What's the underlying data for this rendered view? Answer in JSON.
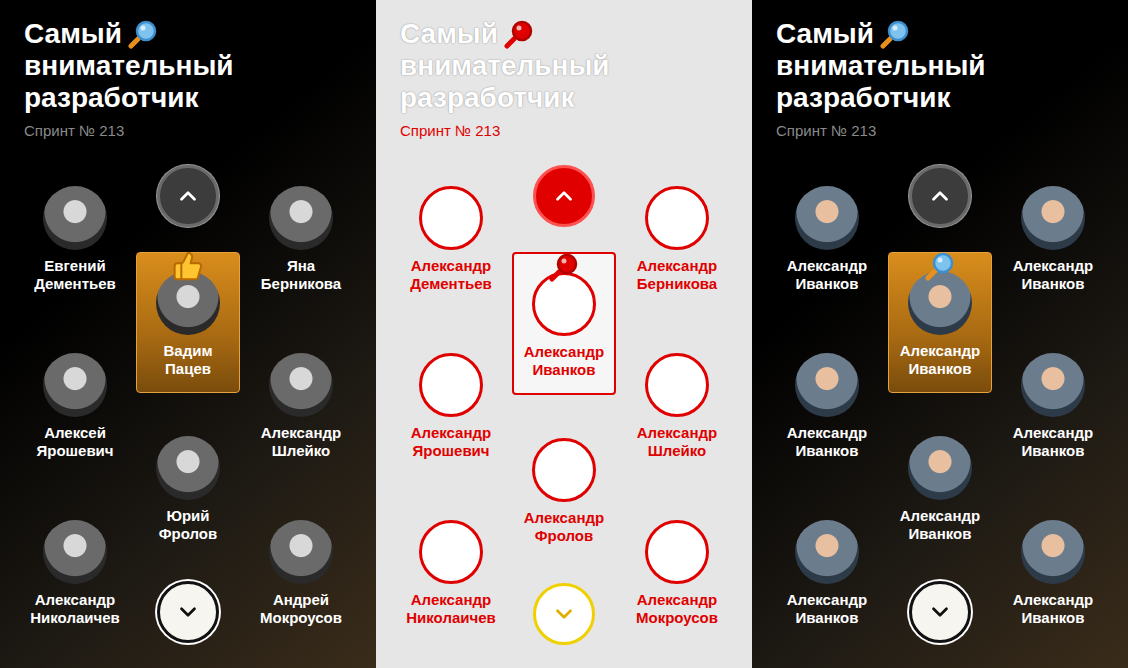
{
  "panels": [
    {
      "kind": "dark",
      "photos": "grayscale",
      "badge": "thumbs-up",
      "title_lines": [
        "Самый",
        "внимательный",
        "разработчик"
      ],
      "sprint": "Спринт № 213",
      "columns": [
        {
          "people": [
            {
              "first": "Евгений",
              "last": "Дементьев",
              "selected": false
            },
            {
              "first": "Алексей",
              "last": "Ярошевич",
              "selected": false
            },
            {
              "first": "Александр",
              "last": "Николаичев",
              "selected": false
            }
          ]
        },
        {
          "people": [
            {
              "first": "Вадим",
              "last": "Пацев",
              "selected": true
            },
            {
              "first": "Юрий",
              "last": "Фролов",
              "selected": false
            }
          ]
        },
        {
          "people": [
            {
              "first": "Яна",
              "last": "Берникова",
              "selected": false
            },
            {
              "first": "Александр",
              "last": "Шлейко",
              "selected": false
            },
            {
              "first": "Андрей",
              "last": "Мокроусов",
              "selected": false
            }
          ]
        }
      ]
    },
    {
      "kind": "diff",
      "photos": "outline",
      "badge": "magnifier",
      "title_lines": [
        "Самый",
        "внимательный",
        "разработчик"
      ],
      "sprint": "Спринт № 213",
      "columns": [
        {
          "people": [
            {
              "first": "Александр",
              "last": "Дементьев",
              "selected": false
            },
            {
              "first": "Александр",
              "last": "Ярошевич",
              "selected": false
            },
            {
              "first": "Александр",
              "last": "Николаичев",
              "selected": false
            }
          ]
        },
        {
          "people": [
            {
              "first": "Александр",
              "last": "Иванков",
              "selected": true
            },
            {
              "first": "Александр",
              "last": "Фролов",
              "selected": false
            }
          ]
        },
        {
          "people": [
            {
              "first": "Александр",
              "last": "Берникова",
              "selected": false
            },
            {
              "first": "Александр",
              "last": "Шлейко",
              "selected": false
            },
            {
              "first": "Александр",
              "last": "Мокроусов",
              "selected": false
            }
          ]
        }
      ]
    },
    {
      "kind": "dark",
      "photos": "color",
      "badge": "magnifier",
      "title_lines": [
        "Самый",
        "внимательный",
        "разработчик"
      ],
      "sprint": "Спринт № 213",
      "columns": [
        {
          "people": [
            {
              "first": "Александр",
              "last": "Иванков",
              "selected": false
            },
            {
              "first": "Александр",
              "last": "Иванков",
              "selected": false
            },
            {
              "first": "Александр",
              "last": "Иванков",
              "selected": false
            }
          ]
        },
        {
          "people": [
            {
              "first": "Александр",
              "last": "Иванков",
              "selected": true
            },
            {
              "first": "Александр",
              "last": "Иванков",
              "selected": false
            }
          ]
        },
        {
          "people": [
            {
              "first": "Александр",
              "last": "Иванков",
              "selected": false
            },
            {
              "first": "Александр",
              "last": "Иванков",
              "selected": false
            },
            {
              "first": "Александр",
              "last": "Иванков",
              "selected": false
            }
          ]
        }
      ]
    }
  ]
}
